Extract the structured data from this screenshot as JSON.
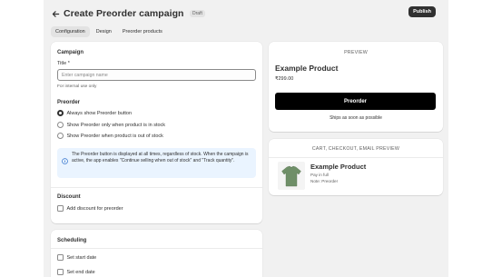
{
  "header": {
    "title": "Create Preorder campaign",
    "badge": "Draft",
    "publish_label": "Publish"
  },
  "tabs": [
    {
      "label": "Configuration",
      "active": true
    },
    {
      "label": "Design",
      "active": false
    },
    {
      "label": "Preorder products",
      "active": false
    }
  ],
  "campaign": {
    "section_title": "Campaign",
    "title_label": "Title *",
    "title_value": "",
    "title_placeholder": "Enter campaign name",
    "title_help": "For internal use only"
  },
  "preorder": {
    "section_title": "Preorder",
    "options": [
      {
        "label": "Always show Preorder button",
        "checked": true
      },
      {
        "label": "Show Preorder only when product is in stock",
        "checked": false
      },
      {
        "label": "Show Preorder when product is out of stock",
        "checked": false
      }
    ],
    "info_text": "The Preorder button is displayed at all times, regardless of stock. When the campaign is active, the app enables \"Continue selling when out of stock\" and \"Track quantity\"."
  },
  "discount": {
    "section_title": "Discount",
    "checkbox_label": "Add discount for preorder"
  },
  "scheduling": {
    "section_title": "Scheduling",
    "start_label": "Set start date",
    "end_label": "Set end date"
  },
  "preview": {
    "heading": "PREVIEW",
    "product_name": "Example Product",
    "price": "₹299.00",
    "button_label": "Preorder",
    "ships_text": "Ships as soon as possible"
  },
  "cart_preview": {
    "heading": "CART, CHECKOUT, EMAIL PREVIEW",
    "product_name": "Example Product",
    "line1": "Pay in full",
    "line2": "Note: Preorder"
  },
  "colors": {
    "page_bg": "#f1f1f1",
    "primary_button": "#303030",
    "preorder_button": "#000000",
    "info_banner": "#eaf4ff",
    "info_icon": "#2c6ecb",
    "shirt": "#6f8f68"
  },
  "icons": [
    "arrow-left-icon",
    "info-icon",
    "tshirt-icon"
  ]
}
